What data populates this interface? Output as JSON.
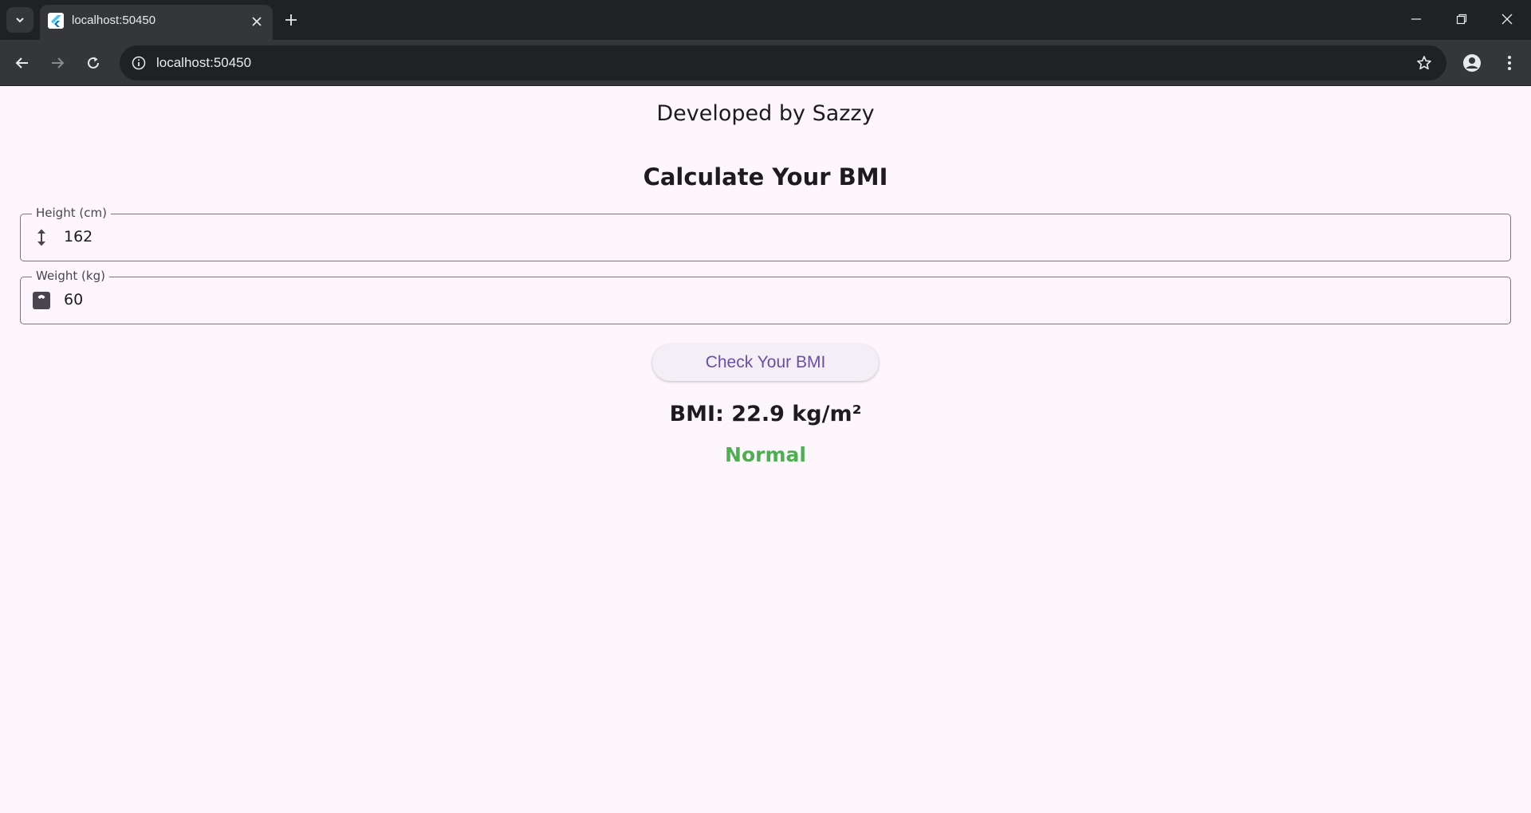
{
  "browser": {
    "tab_title": "localhost:50450",
    "url": "localhost:50450"
  },
  "page": {
    "developer_credit": "Developed by Sazzy",
    "title": "Calculate Your BMI",
    "height_field": {
      "label": "Height (cm)",
      "value": "162",
      "icon": "height-arrows-icon"
    },
    "weight_field": {
      "label": "Weight (kg)",
      "value": "60",
      "icon": "scale-icon"
    },
    "check_button_label": "Check Your BMI",
    "bmi_result": "BMI: 22.9 kg/m²",
    "bmi_category": "Normal",
    "colors": {
      "category": "#4caf50",
      "button_text": "#6750a4",
      "background": "#fdf7fd"
    }
  }
}
